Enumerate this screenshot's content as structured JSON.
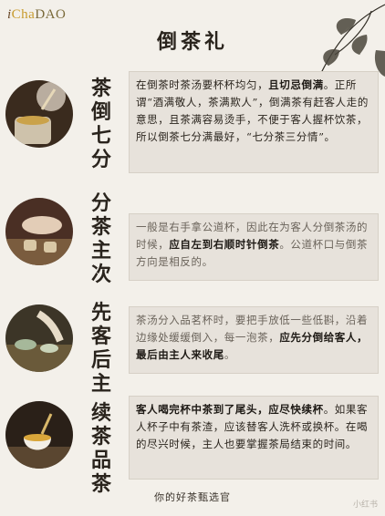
{
  "brand": {
    "i": "i",
    "cha": "Cha",
    "dao": "DAO"
  },
  "title": "倒茶礼",
  "sections": [
    {
      "heading": "茶倒七分",
      "icon": "tea-pour-photo",
      "text_a": "在倒茶时茶汤要杯杯均匀，",
      "bold_a": "且切忌倒满",
      "text_b": "。正所谓“酒满敬人，茶满欺人”，倒满茶有赶客人走的意思，且茶满容易烫手，不便于客人握杯饮茶，所以倒茶七分满最好，“七分茶三分情”。"
    },
    {
      "heading": "分茶主次",
      "icon": "serving-photo",
      "text_a": "一般是右手拿公道杯，因此在为客人分倒茶汤的时候，",
      "bold_a": "应自左到右顺时针倒茶",
      "text_b": "。公道杯口与倒茶方向是相反的。"
    },
    {
      "heading": "先客后主",
      "icon": "guest-cup-photo",
      "text_a": "茶汤分入品茗杯时，要把手放低一些低斟，沿着边缘处缓缓倒入，每一泡茶，",
      "bold_a": "应先分倒给客人，最后由主人来收尾",
      "text_b": "。"
    },
    {
      "heading": "续茶品茶",
      "icon": "refill-photo",
      "text_a": "",
      "bold_a": "客人喝完杯中茶到了尾头，应尽快续杯",
      "text_b": "。如果客人杯子中有茶渣，应该替客人洗杯或换杯。在喝的尽兴时候，主人也要掌握茶局结束的时间。"
    }
  ],
  "footer": "你的好茶甄选官",
  "watermark": "小红书"
}
